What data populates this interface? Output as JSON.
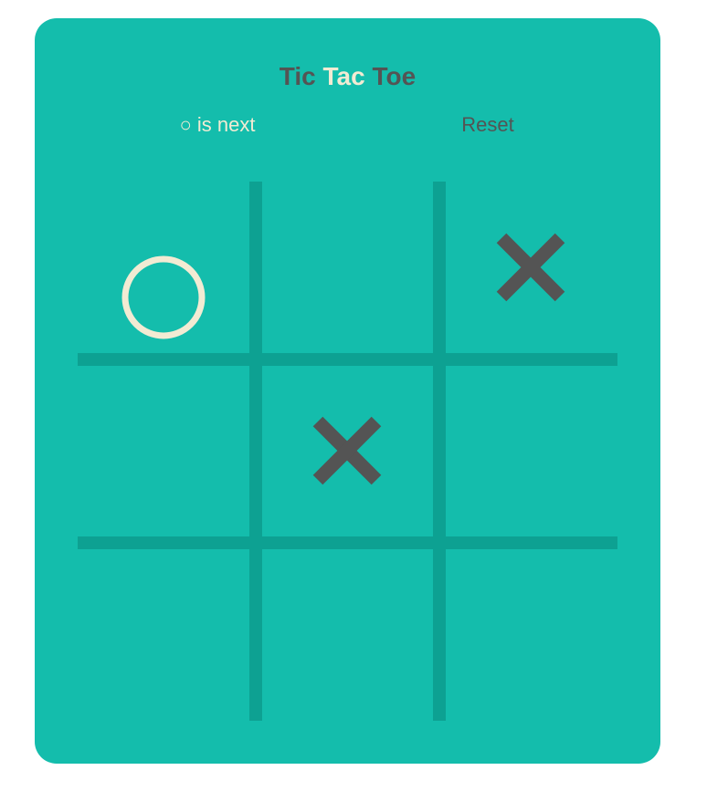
{
  "game": {
    "title_part1": "Tic",
    "title_part2": "Tac",
    "title_part3": "Toe",
    "status_symbol": "○",
    "status_text": "is next",
    "reset_label": "Reset",
    "board": [
      "O",
      "",
      "X",
      "",
      "X",
      "",
      "",
      "",
      ""
    ]
  },
  "colors": {
    "background": "#14bdac",
    "grid_line": "#0da192",
    "x_mark": "#545454",
    "o_mark": "#f2ebd3",
    "title_dark": "#545454",
    "title_light": "#f2ebd3"
  }
}
